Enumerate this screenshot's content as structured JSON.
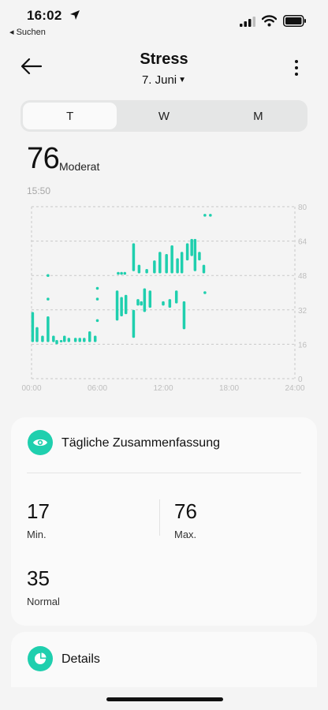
{
  "status_bar": {
    "time": "16:02",
    "back_app": "◂ Suchen",
    "icons": [
      "location-arrow-icon",
      "signal-icon",
      "wifi-icon",
      "battery-icon"
    ]
  },
  "header": {
    "title": "Stress",
    "date": "7. Juni",
    "icons": [
      "back-arrow-icon",
      "more-vertical-icon"
    ]
  },
  "tabs": [
    {
      "label": "T",
      "active": true
    },
    {
      "label": "W",
      "active": false
    },
    {
      "label": "M",
      "active": false
    }
  ],
  "current": {
    "value": "76",
    "label": "Moderat",
    "time": "15:50"
  },
  "colors": {
    "accent": "#1fcfae",
    "grid": "#c8c8c8",
    "axis_text": "#bdbdbd"
  },
  "chart_data": {
    "type": "bar",
    "title": "",
    "xlabel": "",
    "ylabel": "",
    "ylim": [
      0,
      80
    ],
    "y_ticks": [
      "80",
      "64",
      "48",
      "32",
      "16",
      "0"
    ],
    "x_ticks": [
      "00:00",
      "06:00",
      "12:00",
      "18:00",
      "24:00"
    ],
    "x_tick_hours": [
      0,
      6,
      12,
      18,
      24
    ],
    "xlim_hours": [
      0,
      24
    ],
    "grid": true,
    "series": [
      {
        "ranges": [
          {
            "h": 0.1,
            "lo": 17,
            "hi": 31
          },
          {
            "h": 0.5,
            "lo": 17,
            "hi": 24
          },
          {
            "h": 1.0,
            "lo": 17,
            "hi": 20
          },
          {
            "h": 1.5,
            "lo": 17,
            "hi": 29
          },
          {
            "h": 2.0,
            "lo": 17,
            "hi": 20
          },
          {
            "h": 2.3,
            "lo": 16,
            "hi": 18
          },
          {
            "h": 2.7,
            "lo": 17,
            "hi": 18
          },
          {
            "h": 3.0,
            "lo": 17,
            "hi": 20
          },
          {
            "h": 3.4,
            "lo": 17,
            "hi": 19
          },
          {
            "h": 4.0,
            "lo": 17,
            "hi": 19
          },
          {
            "h": 4.4,
            "lo": 17,
            "hi": 19
          },
          {
            "h": 4.8,
            "lo": 17,
            "hi": 19
          },
          {
            "h": 5.3,
            "lo": 17,
            "hi": 22
          },
          {
            "h": 5.8,
            "lo": 17,
            "hi": 20
          },
          {
            "h": 7.8,
            "lo": 27,
            "hi": 41
          },
          {
            "h": 8.2,
            "lo": 29,
            "hi": 38
          },
          {
            "h": 8.6,
            "lo": 30,
            "hi": 39
          },
          {
            "h": 9.3,
            "lo": 19,
            "hi": 32
          },
          {
            "h": 9.3,
            "lo": 50,
            "hi": 63
          },
          {
            "h": 9.7,
            "lo": 34,
            "hi": 37
          },
          {
            "h": 9.8,
            "lo": 49,
            "hi": 53
          },
          {
            "h": 10.0,
            "lo": 34,
            "hi": 36
          },
          {
            "h": 10.3,
            "lo": 31,
            "hi": 42
          },
          {
            "h": 10.5,
            "lo": 49,
            "hi": 51
          },
          {
            "h": 10.8,
            "lo": 33,
            "hi": 41
          },
          {
            "h": 11.2,
            "lo": 49,
            "hi": 55
          },
          {
            "h": 11.7,
            "lo": 49,
            "hi": 59
          },
          {
            "h": 12.0,
            "lo": 34,
            "hi": 36
          },
          {
            "h": 12.3,
            "lo": 49,
            "hi": 58
          },
          {
            "h": 12.6,
            "lo": 33,
            "hi": 37
          },
          {
            "h": 12.8,
            "lo": 49,
            "hi": 62
          },
          {
            "h": 13.2,
            "lo": 35,
            "hi": 41
          },
          {
            "h": 13.3,
            "lo": 49,
            "hi": 56
          },
          {
            "h": 13.7,
            "lo": 49,
            "hi": 59
          },
          {
            "h": 13.9,
            "lo": 23,
            "hi": 36
          },
          {
            "h": 14.2,
            "lo": 55,
            "hi": 63
          },
          {
            "h": 14.6,
            "lo": 57,
            "hi": 65
          },
          {
            "h": 14.9,
            "lo": 50,
            "hi": 65
          },
          {
            "h": 15.3,
            "lo": 55,
            "hi": 59
          },
          {
            "h": 15.7,
            "lo": 49,
            "hi": 53
          }
        ],
        "points": [
          {
            "h": 1.5,
            "v": 48
          },
          {
            "h": 1.5,
            "v": 37
          },
          {
            "h": 6.0,
            "v": 42
          },
          {
            "h": 6.0,
            "v": 37
          },
          {
            "h": 6.0,
            "v": 27
          },
          {
            "h": 7.9,
            "v": 49
          },
          {
            "h": 8.2,
            "v": 49
          },
          {
            "h": 8.5,
            "v": 49
          },
          {
            "h": 15.8,
            "v": 40
          },
          {
            "h": 15.8,
            "v": 76
          },
          {
            "h": 16.3,
            "v": 76
          }
        ]
      }
    ]
  },
  "summary": {
    "title": "Tägliche Zusammenfassung",
    "min_value": "17",
    "min_label": "Min.",
    "max_value": "76",
    "max_label": "Max.",
    "normal_value": "35",
    "normal_label": "Normal"
  },
  "details": {
    "title": "Details"
  }
}
